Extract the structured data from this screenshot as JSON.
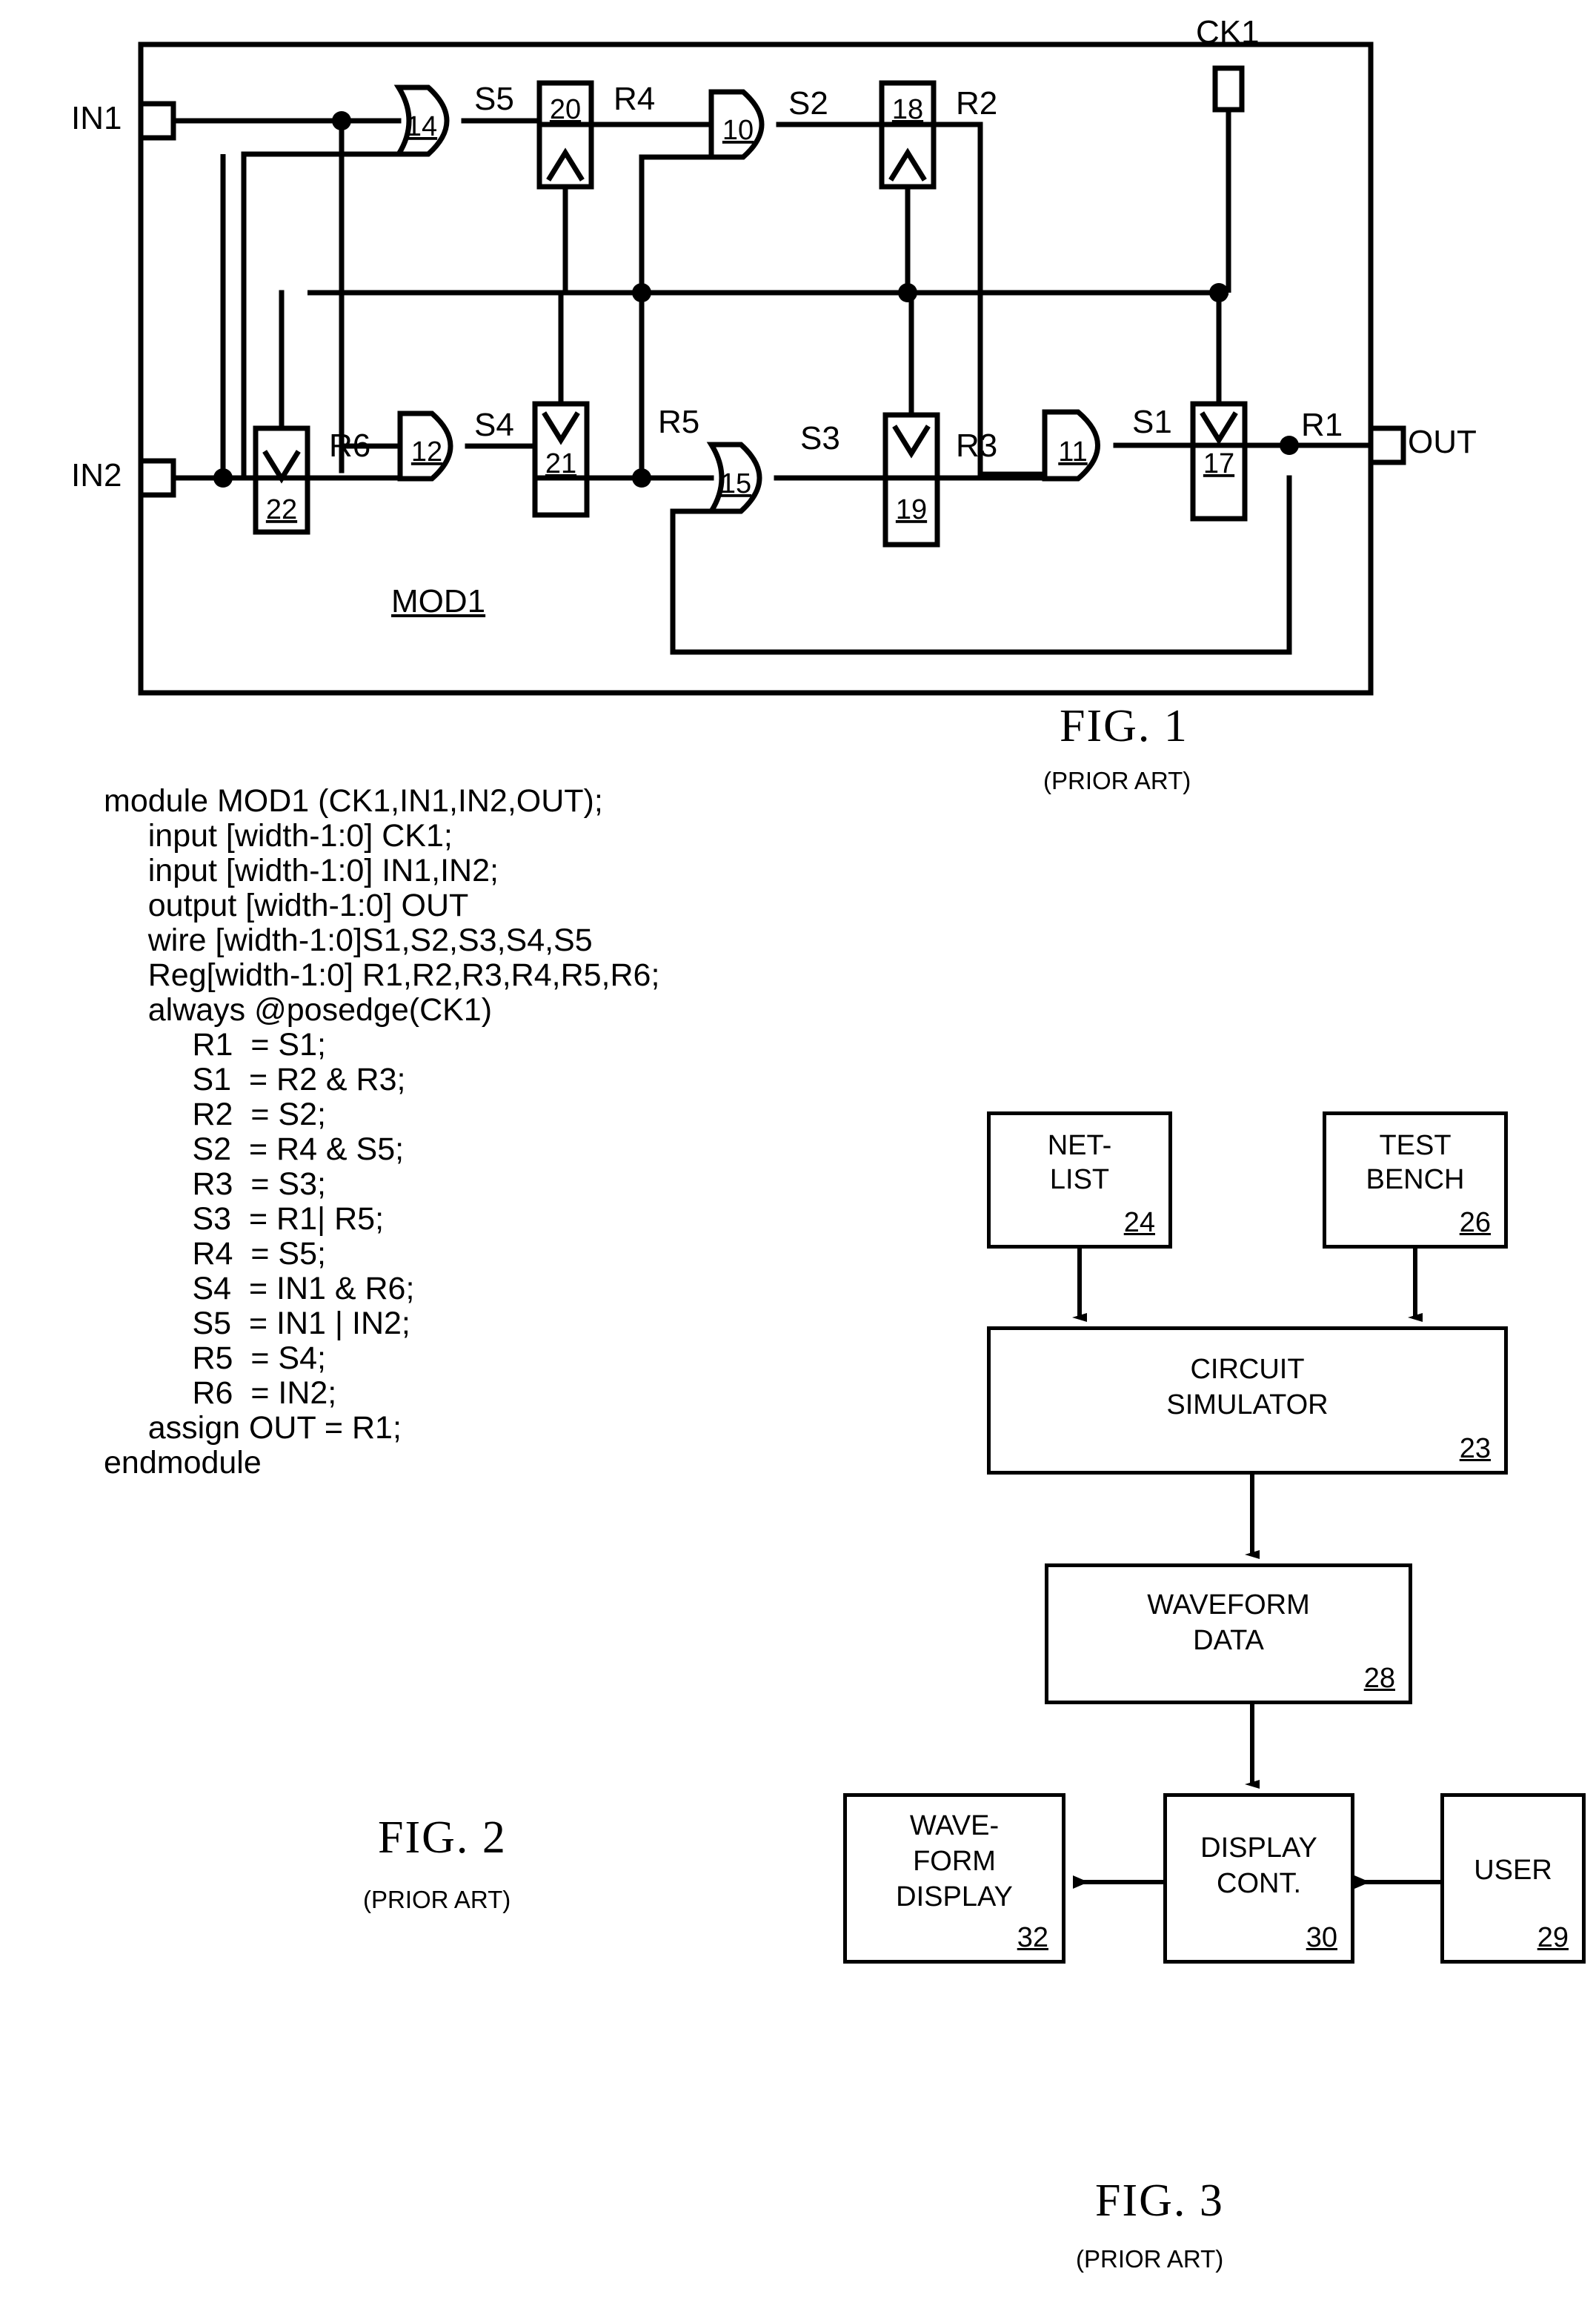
{
  "figures": {
    "fig1": {
      "title": "FIG. 1",
      "subtitle": "(PRIOR ART)",
      "module_label": "MOD1",
      "ports": {
        "in1": "IN1",
        "in2": "IN2",
        "out": "OUT",
        "ck1": "CK1"
      },
      "gates": [
        {
          "id": "14",
          "type": "or-gate",
          "output_signal": "S5"
        },
        {
          "id": "20",
          "type": "register",
          "output_signal": "R4"
        },
        {
          "id": "10",
          "type": "and-gate",
          "output_signal": "S2"
        },
        {
          "id": "18",
          "type": "register",
          "output_signal": "R2"
        },
        {
          "id": "22",
          "type": "register",
          "output_signal": "R6"
        },
        {
          "id": "12",
          "type": "and-gate",
          "output_signal": "S4"
        },
        {
          "id": "21",
          "type": "register",
          "output_signal": "R5"
        },
        {
          "id": "15",
          "type": "or-gate",
          "output_signal": "S3"
        },
        {
          "id": "19",
          "type": "register",
          "output_signal": "R3"
        },
        {
          "id": "11",
          "type": "and-gate",
          "output_signal": "S1"
        },
        {
          "id": "17",
          "type": "register",
          "output_signal": "R1"
        }
      ],
      "signal_labels": [
        "S5",
        "R4",
        "S2",
        "R2",
        "S4",
        "R5",
        "S3",
        "R3",
        "S1",
        "R1",
        "R6"
      ],
      "gate_numbers": [
        "14",
        "20",
        "10",
        "18",
        "22",
        "12",
        "21",
        "15",
        "19",
        "11",
        "17"
      ]
    },
    "fig2": {
      "title": "FIG. 2",
      "subtitle": "(PRIOR ART)",
      "code": [
        "module MOD1 (CK1,IN1,IN2,OUT);",
        "     input [width-1:0] CK1;",
        "     input [width-1:0] IN1,IN2;",
        "     output [width-1:0] OUT",
        "     wire [width-1:0]S1,S2,S3,S4,S5",
        "     Reg[width-1:0] R1,R2,R3,R4,R5,R6;",
        "     always @posedge(CK1)",
        "          R1  = S1;",
        "          S1  = R2 & R3;",
        "          R2  = S2;",
        "          S2  = R4 & S5;",
        "          R3  = S3;",
        "          S3  = R1| R5;",
        "          R4  = S5;",
        "          S4  = IN1 & R6;",
        "          S5  = IN1 | IN2;",
        "          R5  = S4;",
        "          R6  = IN2;",
        "     assign OUT = R1;",
        "endmodule"
      ]
    },
    "fig3": {
      "title": "FIG. 3",
      "subtitle": "(PRIOR ART)",
      "boxes": [
        {
          "name": "netlist",
          "lines": [
            "NET-",
            "LIST"
          ],
          "number": "24"
        },
        {
          "name": "test-bench",
          "lines": [
            "TEST",
            "BENCH"
          ],
          "number": "26"
        },
        {
          "name": "circuit-simulator",
          "lines": [
            "CIRCUIT",
            "SIMULATOR"
          ],
          "number": "23"
        },
        {
          "name": "waveform-data",
          "lines": [
            "WAVEFORM",
            "DATA"
          ],
          "number": "28"
        },
        {
          "name": "waveform-display",
          "lines": [
            "WAVE-",
            "FORM",
            "DISPLAY"
          ],
          "number": "32"
        },
        {
          "name": "display-cont",
          "lines": [
            "DISPLAY",
            "CONT."
          ],
          "number": "30"
        },
        {
          "name": "user",
          "lines": [
            "USER"
          ],
          "number": "29"
        }
      ]
    }
  },
  "colors": {
    "ink": "#000000",
    "paper": "#ffffff"
  }
}
